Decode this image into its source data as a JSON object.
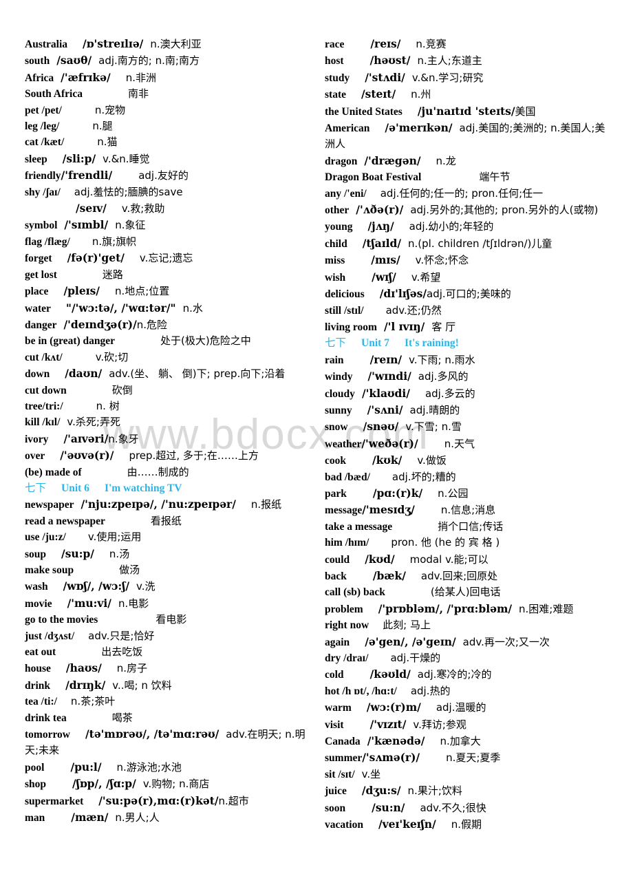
{
  "watermark": {
    "text": "www.bdocx.com"
  },
  "accent_color": "#2ab6e8",
  "left_column": {
    "entries": [
      {
        "word": "Australia",
        "ipa": "/ɒ'streɪlɪə/",
        "gloss": "n.澳大利亚",
        "ws": "sp2",
        "gs": "sp1"
      },
      {
        "word": "south",
        "ipa": "/saʊθ/",
        "gloss": "adj.南方的; n.南;南方",
        "ws": "sp1",
        "gs": "sp1"
      },
      {
        "word": "Africa",
        "ipa": "/'æfrɪkə/",
        "gloss": "n.非洲",
        "ws": "sp1",
        "gs": "sp2"
      },
      {
        "word": "South Africa",
        "ipa": "",
        "gloss": "南非",
        "ws": "sp1",
        "gs": "sp4"
      },
      {
        "word": "pet /pet/",
        "ipa": "",
        "gloss": "n.宠物",
        "ws": "sp1",
        "gs": "sp3"
      },
      {
        "word": "leg /leg/",
        "ipa": "",
        "gloss": "n.腿",
        "ws": "sp1",
        "gs": "sp3"
      },
      {
        "word": "cat /kæt/",
        "ipa": "",
        "gloss": "n.猫",
        "ws": "sp1",
        "gs": "sp3"
      },
      {
        "word": "sleep",
        "ipa": "/sli:p/",
        "gloss": "v.&n.睡觉",
        "ws": "sp2",
        "gs": "sp1"
      },
      {
        "word": "friendly",
        "ipa": "/'frendli/",
        "gloss": "adj.友好的",
        "ws": "sp0",
        "gs": "sp3"
      },
      {
        "word": "shy /ʃaɪ/",
        "ipa": "",
        "gloss": "adj.羞怯的;腼腆的save",
        "ws": "sp1",
        "gs": "sp1"
      },
      {
        "word": "",
        "ipa": "/seɪv/",
        "gloss": "v.救;救助",
        "ws": "sp5",
        "gs": "sp2"
      },
      {
        "word": "symbol",
        "ipa": "/'sɪmbl/",
        "gloss": "n.象征",
        "ws": "sp1",
        "gs": "sp1"
      },
      {
        "word": "flag /flæg/",
        "ipa": "",
        "gloss": "n.旗;旗帜",
        "ws": "sp1",
        "gs": "sp2"
      },
      {
        "word": "forget",
        "ipa": "/fə(r)'get/",
        "gloss": "v.忘记;遗忘",
        "ws": "sp2",
        "gs": "sp2"
      },
      {
        "word": "get lost",
        "ipa": "",
        "gloss": "迷路",
        "ws": "sp1",
        "gs": "sp4"
      },
      {
        "word": "place",
        "ipa": "/pleɪs/",
        "gloss": "n.地点;位置",
        "ws": "sp2",
        "gs": "sp2"
      },
      {
        "word": "water",
        "ipa": "\"/'wɔ:tə/, /'wɑ:tər/\"",
        "gloss": "n.水",
        "ws": "sp2",
        "gs": "sp1"
      },
      {
        "word": "danger",
        "ipa": "/'deɪndʒə(r)/",
        "gloss": "n.危险",
        "ws": "sp1",
        "gs": "sp0"
      },
      {
        "word": "be in (great) danger",
        "ipa": "",
        "gloss": "处于(极大)危险之中",
        "ws": "sp1",
        "gs": "sp4"
      },
      {
        "word": "cut /kʌt/",
        "ipa": "",
        "gloss": "v.砍;切",
        "ws": "sp1",
        "gs": "sp3"
      },
      {
        "word": "down",
        "ipa": "/daʊn/",
        "gloss": "adv.(坐、 躺、 倒)下; prep.向下;沿着",
        "ws": "sp2",
        "gs": "sp1"
      },
      {
        "word": "cut down",
        "ipa": "",
        "gloss": "砍倒",
        "ws": "sp1",
        "gs": "sp4"
      },
      {
        "word": "tree/tri:/",
        "ipa": "",
        "gloss": "n. 树",
        "ws": "sp1",
        "gs": "sp3"
      },
      {
        "word": "kill /kɪl/",
        "ipa": "",
        "gloss": "v.杀死;弄死",
        "ws": "sp1",
        "gs": "sp0"
      },
      {
        "word": "ivory",
        "ipa": "/'aɪvəri/",
        "gloss": "n.象牙",
        "ws": "sp2",
        "gs": "sp0"
      },
      {
        "word": "over",
        "ipa": "/'əʊvə(r)/",
        "gloss": "prep.超过, 多于;在……上方",
        "ws": "sp2",
        "gs": "sp2"
      },
      {
        "word": "(be) made of",
        "ipa": "",
        "gloss": "由……制成的",
        "ws": "sp1",
        "gs": "sp4"
      }
    ],
    "unit_heading": {
      "grade": "七下",
      "unit": "Unit 6",
      "title": "I'm watching TV"
    },
    "entries_after": [
      {
        "word": "newspaper",
        "ipa": "/'nju:zpeɪpə/, /'nu:zpeɪpər/",
        "gloss": "n.报纸",
        "ws": "sp1",
        "gs": "sp2"
      },
      {
        "word": "read a newspaper",
        "ipa": "",
        "gloss": "看报纸",
        "ws": "sp1",
        "gs": "sp4"
      },
      {
        "word": "use /ju:z/",
        "ipa": "",
        "gloss": "v.使用;运用",
        "ws": "sp1",
        "gs": "sp2"
      },
      {
        "word": "soup",
        "ipa": "/su:p/",
        "gloss": "n.汤",
        "ws": "sp2",
        "gs": "sp2"
      },
      {
        "word": "make soup",
        "ipa": "",
        "gloss": "做汤",
        "ws": "sp1",
        "gs": "sp4"
      },
      {
        "word": "wash",
        "ipa": "/wɒʃ/, /wɔ:ʃ/",
        "gloss": "v.洗",
        "ws": "sp2",
        "gs": "sp1"
      },
      {
        "word": "movie",
        "ipa": "/'mu:vi/",
        "gloss": "n.电影",
        "ws": "sp2",
        "gs": "sp1"
      },
      {
        "word": "go to the movies",
        "ipa": "",
        "gloss": "看电影",
        "ws": "sp1",
        "gs": "sp5"
      },
      {
        "word": "just /dʒʌst/",
        "ipa": "",
        "gloss": "adv.只是;恰好",
        "ws": "sp1",
        "gs": "sp1"
      },
      {
        "word": "eat out",
        "ipa": "",
        "gloss": "出去吃饭",
        "ws": "sp1",
        "gs": "sp4"
      },
      {
        "word": "house",
        "ipa": "/haʊs/",
        "gloss": "n.房子",
        "ws": "sp2",
        "gs": "sp2"
      },
      {
        "word": "drink",
        "ipa": "/drɪŋk/",
        "gloss": "v..喝; n 饮料",
        "ws": "sp2",
        "gs": "sp1"
      },
      {
        "word": "tea /ti:/",
        "ipa": "",
        "gloss": "n.茶;茶叶",
        "ws": "sp1",
        "gs": "sp1"
      },
      {
        "word": "drink tea",
        "ipa": "",
        "gloss": "喝茶",
        "ws": "sp1",
        "gs": "sp4"
      },
      {
        "word": "tomorrow",
        "ipa": "/tə'mɒrəʊ/, /tə'mɑ:rəʊ/",
        "gloss": "adv.在明天; n.明天;未来",
        "ws": "sp2",
        "gs": "sp1"
      },
      {
        "word": "pool",
        "ipa": "/pu:l/",
        "gloss": "n.游泳池;水池",
        "ws": "sp3",
        "gs": "sp2"
      },
      {
        "word": "shop",
        "ipa": "/ʃɒp/, /ʃɑ:p/",
        "gloss": "v.购物; n.商店",
        "ws": "sp3",
        "gs": "sp1"
      },
      {
        "word": "supermarket",
        "ipa": "/'su:pə(r),mɑ:(r)kət/",
        "gloss": "n.超市",
        "ws": "sp2",
        "gs": "sp0"
      },
      {
        "word": "man",
        "ipa": "/mæn/",
        "gloss": "n.男人;人",
        "ws": "sp3",
        "gs": "sp1"
      }
    ]
  },
  "right_column": {
    "entries": [
      {
        "word": "race",
        "ipa": "/reɪs/",
        "gloss": "n.竞赛",
        "ws": "sp3",
        "gs": "sp2"
      },
      {
        "word": "host",
        "ipa": "/həʊst/",
        "gloss": "n.主人;东道主",
        "ws": "sp3",
        "gs": "sp1"
      },
      {
        "word": "study",
        "ipa": "/'stʌdi/",
        "gloss": "v.&n.学习;研究",
        "ws": "sp2",
        "gs": "sp1"
      },
      {
        "word": "state",
        "ipa": "/steɪt/",
        "gloss": "n.州",
        "ws": "sp2",
        "gs": "sp2"
      },
      {
        "word": "the United States",
        "ipa": "/ju'naɪtɪd 'steɪts/",
        "gloss": "美国",
        "ws": "sp2",
        "gs": "sp0"
      },
      {
        "word": "American",
        "ipa": "/ə'merɪkən/",
        "gloss": "adj.美国的;美洲的; n.美国人;美洲人",
        "ws": "sp2",
        "gs": "sp1"
      },
      {
        "word": "dragon",
        "ipa": "/'drægən/",
        "gloss": "n.龙",
        "ws": "sp1",
        "gs": "sp2"
      },
      {
        "word": "Dragon Boat Festival",
        "ipa": "",
        "gloss": "端午节",
        "ws": "sp1",
        "gs": "sp5"
      },
      {
        "word": "any /'eni/",
        "ipa": "",
        "gloss": "adj.任何的;任一的; pron.任何;任一",
        "ws": "sp1",
        "gs": "sp1"
      },
      {
        "word": "other",
        "ipa": "/'ʌðə(r)/",
        "gloss": "adj.另外的;其他的; pron.另外的人(或物)",
        "ws": "sp1",
        "gs": "sp1"
      },
      {
        "word": "young",
        "ipa": "/jʌŋ/",
        "gloss": "adj.幼小的;年轻的",
        "ws": "sp2",
        "gs": "sp2"
      },
      {
        "word": "child",
        "ipa": "/tʃaɪld/",
        "gloss": "n.(pl. children /tʃɪldrən/)儿童",
        "ws": "sp2",
        "gs": "sp1"
      },
      {
        "word": "miss",
        "ipa": "/mɪs/",
        "gloss": "v.怀念;怀念",
        "ws": "sp3",
        "gs": "sp2"
      },
      {
        "word": "wish",
        "ipa": "/wɪʃ/",
        "gloss": "v.希望",
        "ws": "sp3",
        "gs": "sp2"
      },
      {
        "word": "delicious",
        "ipa": "/dɪ'lɪʃəs/",
        "gloss": "adj.可口的;美味的",
        "ws": "sp2",
        "gs": "sp0"
      },
      {
        "word": "still /stɪl/",
        "ipa": "",
        "gloss": "adv.还;仍然",
        "ws": "sp1",
        "gs": "sp2"
      },
      {
        "word": "living room",
        "ipa": "/'l ɪvɪŋ/",
        "gloss": "客 厅",
        "ws": "sp1",
        "gs": "sp1"
      }
    ],
    "unit_heading": {
      "grade": "七下",
      "unit": "Unit 7",
      "title": "It's raining!"
    },
    "entries_after": [
      {
        "word": "rain",
        "ipa": "/reɪn/",
        "gloss": "v.下雨; n.雨水",
        "ws": "sp3",
        "gs": "sp1"
      },
      {
        "word": "windy",
        "ipa": "/'wɪndi/",
        "gloss": "adj.多风的",
        "ws": "sp2",
        "gs": "sp1"
      },
      {
        "word": "cloudy",
        "ipa": "/'klaʊdi/",
        "gloss": "adj.多云的",
        "ws": "sp1",
        "gs": "sp2"
      },
      {
        "word": "sunny",
        "ipa": "/'sʌni/",
        "gloss": "adj.晴朗的",
        "ws": "sp2",
        "gs": "sp1"
      },
      {
        "word": "snow",
        "ipa": "/snəʊ/",
        "gloss": "v.下雪; n.雪",
        "ws": "sp2",
        "gs": "sp1"
      },
      {
        "word": "weather",
        "ipa": "/'weðə(r)/",
        "gloss": "n.天气",
        "ws": "sp0",
        "gs": "sp3"
      },
      {
        "word": "cook",
        "ipa": "/kʊk/",
        "gloss": "v.做饭",
        "ws": "sp3",
        "gs": "sp2"
      },
      {
        "word": "bad /bæd/",
        "ipa": "",
        "gloss": "adj.坏的;糟的",
        "ws": "sp1",
        "gs": "sp2"
      },
      {
        "word": "park",
        "ipa": "/pɑ:(r)k/",
        "gloss": "n.公园",
        "ws": "sp3",
        "gs": "sp2"
      },
      {
        "word": "message",
        "ipa": "/'mesɪdʒ/",
        "gloss": "n.信息;消息",
        "ws": "sp0",
        "gs": "sp3"
      },
      {
        "word": "take a message",
        "ipa": "",
        "gloss": "捎个口信;传话",
        "ws": "sp1",
        "gs": "sp4"
      },
      {
        "word": "him /hɪm/",
        "ipa": "",
        "gloss": "pron. 他 (he 的 宾 格 )",
        "ws": "sp1",
        "gs": "sp2"
      },
      {
        "word": "could",
        "ipa": "/kʊd/",
        "gloss": "modal v.能;可以",
        "ws": "sp2",
        "gs": "sp2"
      },
      {
        "word": "back",
        "ipa": "/bæk/",
        "gloss": "adv.回来;回原处",
        "ws": "sp3",
        "gs": "sp2"
      },
      {
        "word": "call (sb) back",
        "ipa": "",
        "gloss": "(给某人)回电话",
        "ws": "sp1",
        "gs": "sp4"
      },
      {
        "word": "problem",
        "ipa": "/'prɒbləm/, /'prɑ:bləm/",
        "gloss": "n.困难;难题",
        "ws": "sp2",
        "gs": "sp1"
      },
      {
        "word": "right now",
        "ipa": "",
        "gloss": "此刻; 马上",
        "ws": "sp1",
        "gs": "sp1"
      },
      {
        "word": "again",
        "ipa": "/ə'gen/, /ə'geɪn/",
        "gloss": "adv.再一次;又一次",
        "ws": "sp2",
        "gs": "sp1"
      },
      {
        "word": "dry /draɪ/",
        "ipa": "",
        "gloss": "adj.干燥的",
        "ws": "sp1",
        "gs": "sp2"
      },
      {
        "word": "cold",
        "ipa": "/kəʊld/",
        "gloss": "adj.寒冷的;冷的",
        "ws": "sp3",
        "gs": "sp1"
      },
      {
        "word": "hot /h ɒt/, /hɑ:t/",
        "ipa": "",
        "gloss": "adj.热的",
        "ws": "sp1",
        "gs": "sp1"
      },
      {
        "word": "warm",
        "ipa": "/wɔ:(r)m/",
        "gloss": "adj.温暖的",
        "ws": "sp2",
        "gs": "sp2"
      },
      {
        "word": "visit",
        "ipa": "/'vɪzɪt/",
        "gloss": "v.拜访;参观",
        "ws": "sp3",
        "gs": "sp1"
      },
      {
        "word": "Canada",
        "ipa": "/'kænədə/",
        "gloss": "n.加拿大",
        "ws": "sp1",
        "gs": "sp2"
      },
      {
        "word": "summer",
        "ipa": "/'sʌmə(r)/",
        "gloss": "n.夏天;夏季",
        "ws": "sp0",
        "gs": "sp3"
      },
      {
        "word": "sit /sɪt/",
        "ipa": "",
        "gloss": "v.坐",
        "ws": "sp1",
        "gs": "sp0"
      },
      {
        "word": "juice",
        "ipa": "/dʒu:s/",
        "gloss": "n.果汁;饮料",
        "ws": "sp2",
        "gs": "sp1"
      },
      {
        "word": "soon",
        "ipa": "/su:n/",
        "gloss": "adv.不久;很快",
        "ws": "sp3",
        "gs": "sp2"
      },
      {
        "word": "vacation",
        "ipa": "/veɪ'keɪʃn/",
        "gloss": "n.假期",
        "ws": "sp2",
        "gs": "sp2"
      }
    ]
  }
}
